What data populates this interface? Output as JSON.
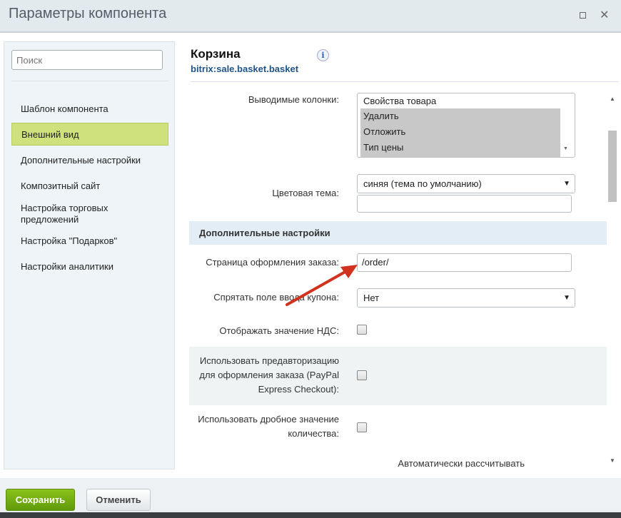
{
  "window": {
    "title": "Параметры компонента",
    "maximize_icon": "maximize-icon",
    "close_icon": "close-icon"
  },
  "sidebar": {
    "search_placeholder": "Поиск",
    "items": [
      {
        "label": "Шаблон компонента"
      },
      {
        "label": "Внешний вид",
        "active": true
      },
      {
        "label": "Дополнительные настройки"
      },
      {
        "label": "Композитный сайт"
      },
      {
        "label": "Настройка торговых предложений"
      },
      {
        "label": "Настройка \"Подарков\""
      },
      {
        "label": "Настройки аналитики"
      }
    ]
  },
  "component": {
    "title": "Корзина",
    "code": "bitrix:sale.basket.basket",
    "info": "i"
  },
  "fields": {
    "columns_label": "Выводимые колонки:",
    "columns_options": [
      "Свойства товара",
      "Удалить",
      "Отложить",
      "Тип цены"
    ],
    "theme_label": "Цветовая тема:",
    "theme_value": "синяя (тема по умолчанию)",
    "theme_extra": "",
    "section_title": "Дополнительные настройки",
    "order_page_label": "Страница оформления заказа:",
    "order_page_value": "/order/",
    "hide_coupon_label": "Спрятать поле ввода купона:",
    "hide_coupon_value": "Нет",
    "vat_label": "Отображать значение НДС:",
    "preauth_label": "Использовать предавторизацию для оформления заказа (PayPal Express Checkout):",
    "fractional_label": "Использовать дробное значение количества:",
    "auto_label": "Автоматически рассчитывать"
  },
  "footer": {
    "save": "Сохранить",
    "cancel": "Отменить"
  },
  "colors": {
    "active": "#cfe17d",
    "save": "#6fa80f",
    "arrow": "#d0321e"
  }
}
